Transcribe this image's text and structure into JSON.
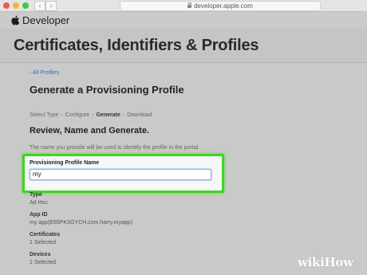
{
  "browser": {
    "url": "developer.apple.com",
    "back_glyph": "‹",
    "forward_glyph": "›"
  },
  "devnav": {
    "brand": "Developer"
  },
  "header": {
    "title": "Certificates, Identifiers & Profiles"
  },
  "main": {
    "back_link": "‹ All Profiles",
    "page_title": "Generate a Provisioning Profile",
    "steps": [
      {
        "label": "Select Type",
        "current": false
      },
      {
        "label": "Configure",
        "current": false
      },
      {
        "label": "Generate",
        "current": true
      },
      {
        "label": "Download",
        "current": false
      }
    ],
    "step_separator": "›",
    "section_title": "Review, Name and Generate.",
    "hint": "The name you provide will be used to identify the profile in the portal.",
    "field": {
      "label": "Provisioning Profile Name",
      "value": "my"
    },
    "info": [
      {
        "label": "Type",
        "value": "Ad Hoc"
      },
      {
        "label": "App ID",
        "value": "my app(E65PK5GYCH.com.harry.myapp)"
      },
      {
        "label": "Certificates",
        "value": "1 Selected"
      },
      {
        "label": "Devices",
        "value": "1 Selected"
      }
    ]
  },
  "watermark": {
    "wiki": "wiki",
    "how": "How"
  },
  "colors": {
    "highlight": "#3ed523",
    "link": "#2b6fc4"
  }
}
